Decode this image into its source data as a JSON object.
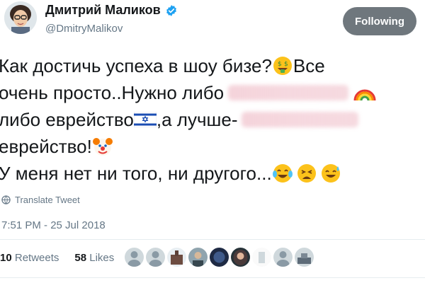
{
  "user": {
    "name": "Дмитрий Маликов",
    "handle": "@DmitryMalikov",
    "follow_label": "Following"
  },
  "tweet": {
    "line1_a": "Как достичь успеха в шоу бизе?",
    "line1_b": "Все",
    "line2_a": "очень просто..Нужно либо",
    "line3_a": "либо еврейство",
    "line3_b": ",а лучше-",
    "line4_a": "еврейство!",
    "line5_a": "У меня нет ни того, ни другого..."
  },
  "translate_label": "Translate Tweet",
  "timestamp": "7:51 PM - 25 Jul 2018",
  "stats": {
    "retweets_count": "10",
    "retweets_label": "Retweets",
    "likes_count": "58",
    "likes_label": "Likes"
  },
  "colors": {
    "verified": "#1da1f2",
    "follow_bg": "#6f777d",
    "muted_text": "#657786"
  },
  "icons": [
    "verified-badge-icon",
    "money-face-emoji",
    "rainbow-emoji",
    "israel-flag-emoji",
    "clown-face-emoji",
    "crying-laughing-emoji",
    "weary-face-emoji",
    "sweat-smile-emoji",
    "globe-icon"
  ]
}
